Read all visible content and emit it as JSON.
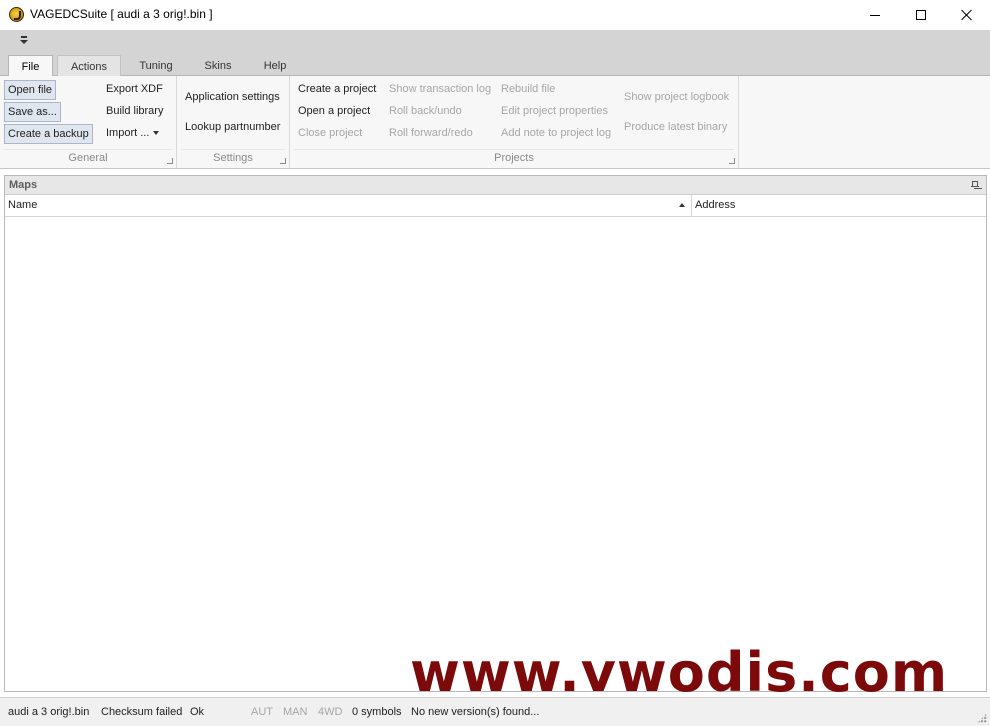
{
  "window": {
    "title": "VAGEDCSuite [ audi a 3 orig!.bin ]",
    "icon": "app-logo-icon"
  },
  "tabs": [
    {
      "label": "File",
      "active": true
    },
    {
      "label": "Actions",
      "active": false
    },
    {
      "label": "Tuning",
      "active": false
    },
    {
      "label": "Skins",
      "active": false
    },
    {
      "label": "Help",
      "active": false
    }
  ],
  "ribbon": {
    "general": {
      "label": "General",
      "open_file": "Open file",
      "save_as": "Save as...",
      "create_backup": "Create a backup",
      "export_xdf": "Export XDF",
      "build_library": "Build library",
      "import": "Import ..."
    },
    "settings": {
      "label": "Settings",
      "application_settings": "Application settings",
      "lookup_partnumber": "Lookup partnumber"
    },
    "projects": {
      "label": "Projects",
      "create_project": "Create a project",
      "open_project": "Open a project",
      "close_project": "Close project",
      "show_transaction_log": "Show transaction log",
      "roll_back": "Roll back/undo",
      "roll_forward": "Roll forward/redo",
      "rebuild_file": "Rebuild file",
      "edit_project_properties": "Edit project properties",
      "add_note": "Add note to project log",
      "show_project_logbook": "Show project logbook",
      "produce_latest_binary": "Produce latest binary"
    }
  },
  "maps_panel": {
    "title": "Maps",
    "columns": [
      "Name",
      "Address"
    ],
    "rows": []
  },
  "watermark": "www.vwodis.com",
  "status": {
    "file": "audi a 3 orig!.bin",
    "checksum": "Checksum failed",
    "ok": "Ok",
    "aut": "AUT",
    "man": "MAN",
    "fwd": "4WD",
    "symbols": "0 symbols",
    "version": "No new version(s) found..."
  },
  "colors": {
    "selected_button_bg": "#dfe6ef",
    "selected_button_border": "#a9b7c9",
    "disabled_text": "#a6a6a6",
    "watermark": "#7c0a0a"
  }
}
